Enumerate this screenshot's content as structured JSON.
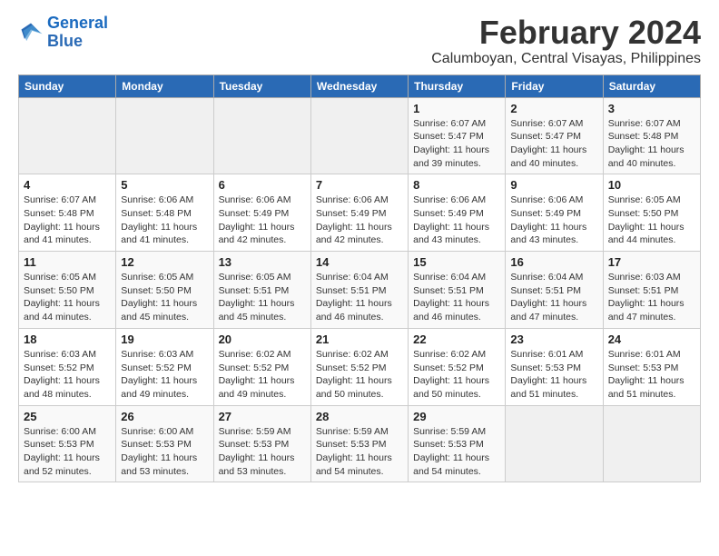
{
  "logo": {
    "text_general": "General",
    "text_blue": "Blue"
  },
  "title": "February 2024",
  "subtitle": "Calumboyan, Central Visayas, Philippines",
  "calendar": {
    "headers": [
      "Sunday",
      "Monday",
      "Tuesday",
      "Wednesday",
      "Thursday",
      "Friday",
      "Saturday"
    ],
    "weeks": [
      [
        {
          "day": "",
          "info": ""
        },
        {
          "day": "",
          "info": ""
        },
        {
          "day": "",
          "info": ""
        },
        {
          "day": "",
          "info": ""
        },
        {
          "day": "1",
          "info": "Sunrise: 6:07 AM\nSunset: 5:47 PM\nDaylight: 11 hours and 39 minutes."
        },
        {
          "day": "2",
          "info": "Sunrise: 6:07 AM\nSunset: 5:47 PM\nDaylight: 11 hours and 40 minutes."
        },
        {
          "day": "3",
          "info": "Sunrise: 6:07 AM\nSunset: 5:48 PM\nDaylight: 11 hours and 40 minutes."
        }
      ],
      [
        {
          "day": "4",
          "info": "Sunrise: 6:07 AM\nSunset: 5:48 PM\nDaylight: 11 hours and 41 minutes."
        },
        {
          "day": "5",
          "info": "Sunrise: 6:06 AM\nSunset: 5:48 PM\nDaylight: 11 hours and 41 minutes."
        },
        {
          "day": "6",
          "info": "Sunrise: 6:06 AM\nSunset: 5:49 PM\nDaylight: 11 hours and 42 minutes."
        },
        {
          "day": "7",
          "info": "Sunrise: 6:06 AM\nSunset: 5:49 PM\nDaylight: 11 hours and 42 minutes."
        },
        {
          "day": "8",
          "info": "Sunrise: 6:06 AM\nSunset: 5:49 PM\nDaylight: 11 hours and 43 minutes."
        },
        {
          "day": "9",
          "info": "Sunrise: 6:06 AM\nSunset: 5:49 PM\nDaylight: 11 hours and 43 minutes."
        },
        {
          "day": "10",
          "info": "Sunrise: 6:05 AM\nSunset: 5:50 PM\nDaylight: 11 hours and 44 minutes."
        }
      ],
      [
        {
          "day": "11",
          "info": "Sunrise: 6:05 AM\nSunset: 5:50 PM\nDaylight: 11 hours and 44 minutes."
        },
        {
          "day": "12",
          "info": "Sunrise: 6:05 AM\nSunset: 5:50 PM\nDaylight: 11 hours and 45 minutes."
        },
        {
          "day": "13",
          "info": "Sunrise: 6:05 AM\nSunset: 5:51 PM\nDaylight: 11 hours and 45 minutes."
        },
        {
          "day": "14",
          "info": "Sunrise: 6:04 AM\nSunset: 5:51 PM\nDaylight: 11 hours and 46 minutes."
        },
        {
          "day": "15",
          "info": "Sunrise: 6:04 AM\nSunset: 5:51 PM\nDaylight: 11 hours and 46 minutes."
        },
        {
          "day": "16",
          "info": "Sunrise: 6:04 AM\nSunset: 5:51 PM\nDaylight: 11 hours and 47 minutes."
        },
        {
          "day": "17",
          "info": "Sunrise: 6:03 AM\nSunset: 5:51 PM\nDaylight: 11 hours and 47 minutes."
        }
      ],
      [
        {
          "day": "18",
          "info": "Sunrise: 6:03 AM\nSunset: 5:52 PM\nDaylight: 11 hours and 48 minutes."
        },
        {
          "day": "19",
          "info": "Sunrise: 6:03 AM\nSunset: 5:52 PM\nDaylight: 11 hours and 49 minutes."
        },
        {
          "day": "20",
          "info": "Sunrise: 6:02 AM\nSunset: 5:52 PM\nDaylight: 11 hours and 49 minutes."
        },
        {
          "day": "21",
          "info": "Sunrise: 6:02 AM\nSunset: 5:52 PM\nDaylight: 11 hours and 50 minutes."
        },
        {
          "day": "22",
          "info": "Sunrise: 6:02 AM\nSunset: 5:52 PM\nDaylight: 11 hours and 50 minutes."
        },
        {
          "day": "23",
          "info": "Sunrise: 6:01 AM\nSunset: 5:53 PM\nDaylight: 11 hours and 51 minutes."
        },
        {
          "day": "24",
          "info": "Sunrise: 6:01 AM\nSunset: 5:53 PM\nDaylight: 11 hours and 51 minutes."
        }
      ],
      [
        {
          "day": "25",
          "info": "Sunrise: 6:00 AM\nSunset: 5:53 PM\nDaylight: 11 hours and 52 minutes."
        },
        {
          "day": "26",
          "info": "Sunrise: 6:00 AM\nSunset: 5:53 PM\nDaylight: 11 hours and 53 minutes."
        },
        {
          "day": "27",
          "info": "Sunrise: 5:59 AM\nSunset: 5:53 PM\nDaylight: 11 hours and 53 minutes."
        },
        {
          "day": "28",
          "info": "Sunrise: 5:59 AM\nSunset: 5:53 PM\nDaylight: 11 hours and 54 minutes."
        },
        {
          "day": "29",
          "info": "Sunrise: 5:59 AM\nSunset: 5:53 PM\nDaylight: 11 hours and 54 minutes."
        },
        {
          "day": "",
          "info": ""
        },
        {
          "day": "",
          "info": ""
        }
      ]
    ]
  }
}
